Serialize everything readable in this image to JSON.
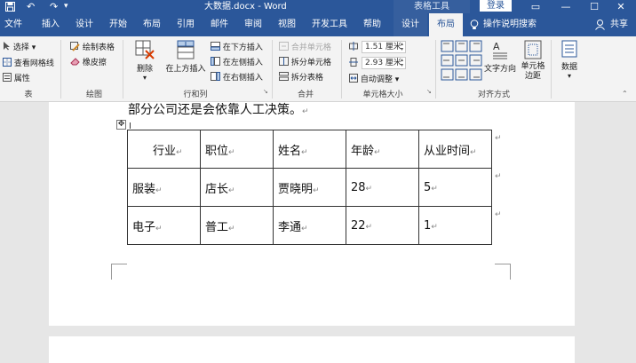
{
  "window": {
    "title": "大数据.docx  -  Word",
    "context_group": "表格工具",
    "login": "登录"
  },
  "tabs": [
    {
      "label": "文件"
    },
    {
      "label": "插入"
    },
    {
      "label": "设计"
    },
    {
      "label": "开始"
    },
    {
      "label": "布局"
    },
    {
      "label": "引用"
    },
    {
      "label": "邮件"
    },
    {
      "label": "审阅"
    },
    {
      "label": "视图"
    },
    {
      "label": "开发工具"
    },
    {
      "label": "帮助"
    },
    {
      "label": "设计"
    },
    {
      "label": "布局"
    }
  ],
  "tell_me": "操作说明搜索",
  "share": "共享",
  "ribbon": {
    "table": {
      "select": "选择",
      "gridlines": "查看网格线",
      "properties": "属性",
      "group": "表"
    },
    "draw": {
      "draw_table": "绘制表格",
      "eraser": "橡皮擦",
      "group": "绘图"
    },
    "rows_cols": {
      "delete": "删除",
      "insert_above": "在上方插入",
      "insert_below": "在下方插入",
      "insert_left": "在左侧插入",
      "insert_right": "在右侧插入",
      "group": "行和列"
    },
    "merge": {
      "merge_cells": "合并单元格",
      "split_cells": "拆分单元格",
      "split_table": "拆分表格",
      "group": "合并"
    },
    "cell_size": {
      "height": "1.51 厘米",
      "width": "2.93 厘米",
      "autofit": "自动调整",
      "group": "单元格大小"
    },
    "alignment": {
      "text_direction": "文字方向",
      "cell_margins": "单元格边距",
      "group": "对齐方式"
    },
    "data": {
      "label": "数据"
    }
  },
  "document": {
    "paragraph": "部分公司还是会依靠人工决策。",
    "table": [
      [
        "行业",
        "职位",
        "姓名",
        "年龄",
        "从业时间"
      ],
      [
        "服装",
        "店长",
        "贾晓明",
        "28",
        "5"
      ],
      [
        "电子",
        "普工",
        "李通",
        "22",
        "1"
      ]
    ]
  }
}
